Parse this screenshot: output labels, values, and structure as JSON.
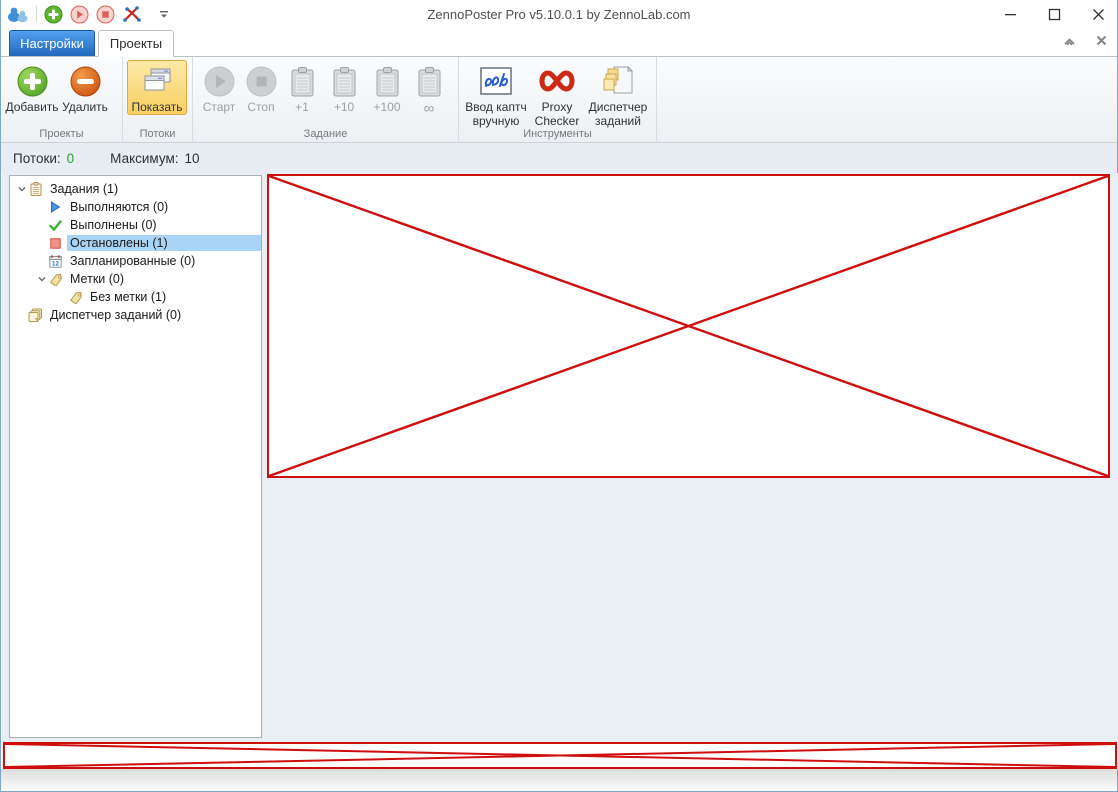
{
  "window": {
    "title": "ZennoPoster Pro v5.10.0.1 by ZennoLab.com",
    "controls": {
      "minimize": "minimize",
      "maximize": "maximize",
      "close": "close"
    }
  },
  "qat": {
    "icons": [
      "zennolab-logo",
      "add-task",
      "start-task",
      "stop-task",
      "projectmaker",
      "customize-dropdown"
    ]
  },
  "tabs": {
    "settings": "Настройки",
    "projects": "Проекты"
  },
  "ribbon_right": {
    "collapse_icon": "chevron-up",
    "close_icon": "close-x"
  },
  "ribbon": {
    "groups": [
      {
        "label": "Проекты",
        "buttons": [
          {
            "label": "Добавить",
            "icon": "plus-circle"
          },
          {
            "label": "Удалить",
            "icon": "minus-circle"
          }
        ]
      },
      {
        "label": "Потоки",
        "buttons": [
          {
            "label": "Показать",
            "icon": "windows-stack",
            "highlighted": true
          }
        ]
      },
      {
        "label": "Задание",
        "buttons": [
          {
            "label": "Старт",
            "icon": "play-circle-gray",
            "disabled": true
          },
          {
            "label": "Стоп",
            "icon": "stop-circle-gray",
            "disabled": true
          },
          {
            "label": "+1",
            "icon": "clipboard-gray",
            "disabled": true
          },
          {
            "label": "+10",
            "icon": "clipboard-gray",
            "disabled": true
          },
          {
            "label": "+100",
            "icon": "clipboard-gray",
            "disabled": true
          },
          {
            "label": "∞",
            "icon": "clipboard-gray",
            "disabled": true
          }
        ]
      },
      {
        "label": "Инструменты",
        "buttons": [
          {
            "label": "Ввод каптч вручную",
            "icon": "captcha-image"
          },
          {
            "label": "Proxy Checker",
            "icon": "infinity-red"
          },
          {
            "label": "Диспетчер заданий",
            "icon": "task-notes"
          }
        ]
      }
    ]
  },
  "threads_bar": {
    "threads_label": "Потоки:",
    "threads_value": "0",
    "max_label": "Максимум:",
    "max_value": "10"
  },
  "tree": {
    "items": [
      {
        "label": "Задания (1)",
        "icon": "clipboard",
        "level": 0,
        "expanded": true
      },
      {
        "label": "Выполняются (0)",
        "icon": "play-blue",
        "level": 1
      },
      {
        "label": "Выполнены (0)",
        "icon": "check-green",
        "level": 1
      },
      {
        "label": "Остановлены (1)",
        "icon": "stop-red-square",
        "level": 1,
        "selected": true
      },
      {
        "label": "Запланированные (0)",
        "icon": "calendar-12",
        "level": 1
      },
      {
        "label": "Метки (0)",
        "icon": "tag-yellow",
        "level": 1,
        "expanded": true
      },
      {
        "label": "Без метки (1)",
        "icon": "tag-yellow",
        "level": 2
      },
      {
        "label": "Диспетчер заданий (0)",
        "icon": "documents-stack",
        "level": 0
      }
    ]
  },
  "placeholders": {
    "main": "broken-image-placeholder",
    "bottom": "broken-image-placeholder"
  },
  "colors": {
    "accent_red": "#cf0e0e",
    "tab_blue": "#2268bd",
    "selection_blue": "#a9d4f5",
    "highlight_yellow": "#f8cf5f",
    "count_green": "#2fa32f"
  }
}
